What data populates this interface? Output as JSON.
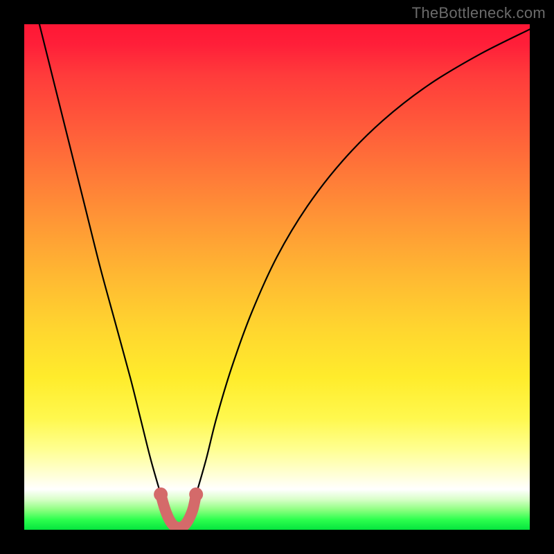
{
  "watermark": "TheBottleneck.com",
  "chart_data": {
    "type": "line",
    "title": "",
    "xlabel": "",
    "ylabel": "",
    "xlim": [
      0,
      100
    ],
    "ylim": [
      0,
      100
    ],
    "grid": false,
    "legend": false,
    "series": [
      {
        "name": "bottleneck-curve",
        "x": [
          3,
          6,
          9,
          12,
          15,
          18,
          21,
          23,
          25,
          27,
          28,
          29,
          30,
          31,
          32,
          33,
          34,
          36,
          38,
          41,
          45,
          50,
          56,
          63,
          71,
          80,
          90,
          100
        ],
        "values": [
          100,
          88,
          76,
          64,
          52,
          41,
          30,
          22,
          14,
          7,
          3.5,
          1.5,
          0.5,
          0.5,
          1.5,
          3.5,
          7,
          14,
          22,
          32,
          43,
          54,
          64,
          73,
          81,
          88,
          94,
          99
        ]
      },
      {
        "name": "marker-band",
        "x": [
          27,
          27.8,
          28.6,
          29.4,
          30.2,
          31,
          31.8,
          32.6,
          33.4,
          34
        ],
        "values": [
          7,
          4.2,
          2.2,
          1,
          0.5,
          0.5,
          1,
          2.2,
          4.2,
          7
        ]
      }
    ],
    "marker_color": "#d46a6a",
    "curve_color": "#000000"
  }
}
